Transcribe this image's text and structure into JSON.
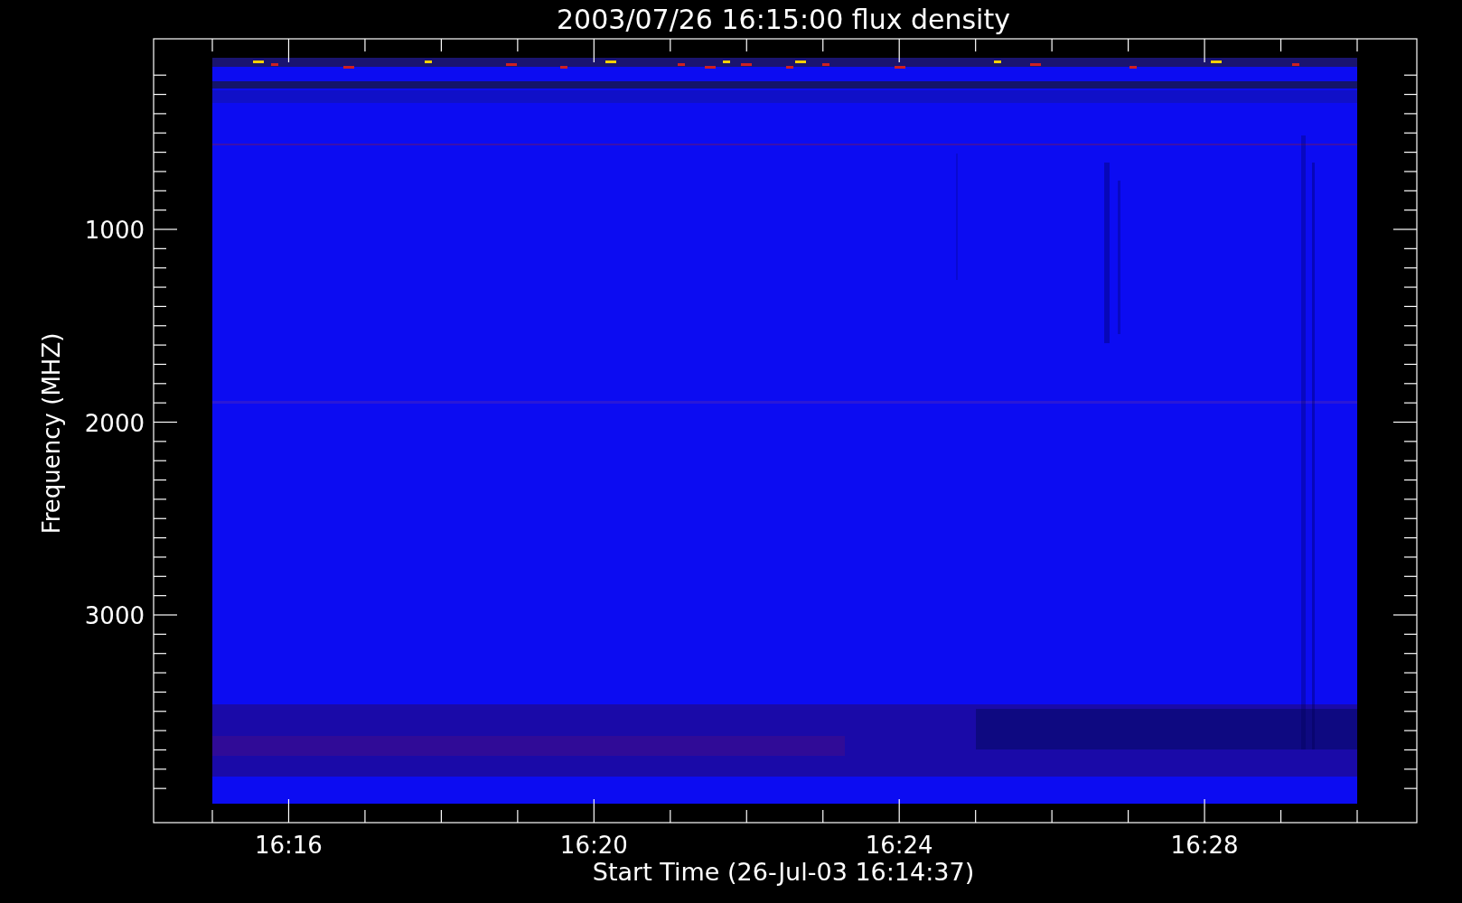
{
  "title": "2003/07/26 16:15:00 flux density",
  "y_axis": {
    "label": "Frequency (MHZ)",
    "tick_labels": [
      "1000",
      "2000",
      "3000"
    ]
  },
  "x_axis": {
    "label": "Start Time (26-Jul-03 16:14:37)",
    "tick_labels": [
      "16:16",
      "16:20",
      "16:24",
      "16:28"
    ]
  }
}
